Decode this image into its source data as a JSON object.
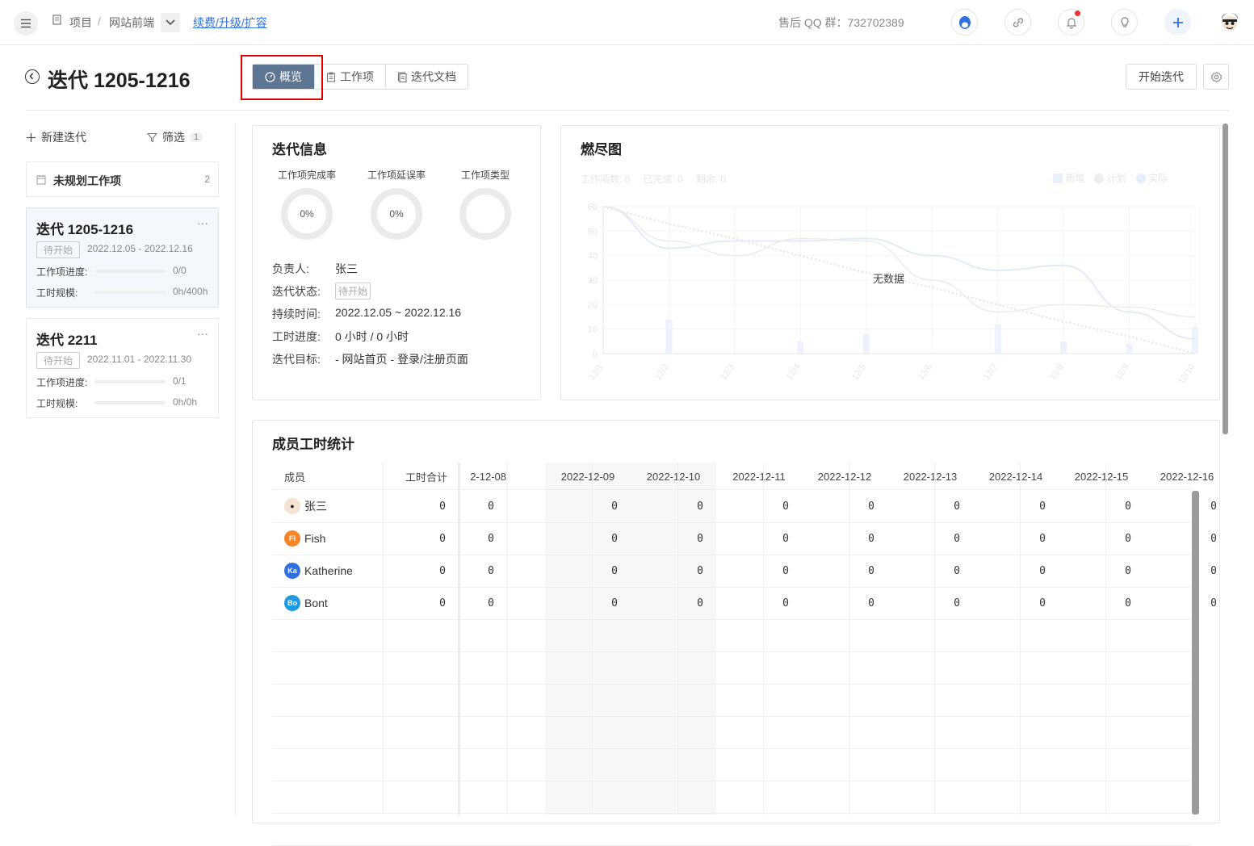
{
  "topbar": {
    "breadcrumb_project": "项目",
    "breadcrumb_sep": "/",
    "breadcrumb_current": "网站前端",
    "renew_link": "续费/升级/扩容",
    "qq_group": "售后 QQ 群：732702389"
  },
  "header": {
    "title": "迭代 1205-1216",
    "tabs": [
      {
        "label": "概览",
        "icon": "dashboard-icon"
      },
      {
        "label": "工作项",
        "icon": "clipboard-icon"
      },
      {
        "label": "迭代文档",
        "icon": "document-icon"
      }
    ],
    "start_button": "开始迭代"
  },
  "sidebar": {
    "new_iteration": "新建迭代",
    "filter": "筛选",
    "filter_count": "1",
    "unplanned_label": "未规划工作项",
    "unplanned_count": "2",
    "iterations": [
      {
        "name": "迭代 1205-1216",
        "status": "待开始",
        "dates": "2022.12.05 - 2022.12.16",
        "progress_label": "工作项进度:",
        "progress_value": "0/0",
        "hours_label": "工时规模:",
        "hours_value": "0h/400h"
      },
      {
        "name": "迭代 2211",
        "status": "待开始",
        "dates": "2022.11.01 - 2022.11.30",
        "progress_label": "工作项进度:",
        "progress_value": "0/1",
        "hours_label": "工时规模:",
        "hours_value": "0h/0h"
      }
    ]
  },
  "info": {
    "title": "迭代信息",
    "rings": [
      {
        "label": "工作项完成率",
        "value": "0%"
      },
      {
        "label": "工作项延误率",
        "value": "0%"
      },
      {
        "label": "工作项类型",
        "value": ""
      }
    ],
    "owner_label": "负责人:",
    "owner": "张三",
    "status_label": "迭代状态:",
    "status": "待开始",
    "duration_label": "持续时间:",
    "duration": "2022.12.05 ~ 2022.12.16",
    "hours_label": "工时进度:",
    "hours": "0 小时 / 0 小时",
    "goal_label": "迭代目标:",
    "goal": "- 网站首页 - 登录/注册页面"
  },
  "chart_data": {
    "type": "line",
    "title": "燃尽图",
    "summary": [
      "工作项数: 0",
      "已完成: 0",
      "剩余: 0"
    ],
    "legend": [
      "新增",
      "计划",
      "实际"
    ],
    "no_data": "无数据",
    "categories": [
      "12/1",
      "12/2",
      "12/3",
      "12/4",
      "12/5",
      "12/6",
      "12/7",
      "12/8",
      "12/9",
      "12/10"
    ],
    "ylim": [
      0,
      60
    ],
    "yticks": [
      0,
      10,
      20,
      30,
      40,
      50,
      60
    ],
    "series": [
      {
        "name": "新增",
        "values": [
          0,
          14,
          0,
          5,
          8,
          0,
          12,
          5,
          4,
          11
        ]
      },
      {
        "name": "计划",
        "values": [
          60,
          53,
          47,
          40,
          33,
          27,
          20,
          13,
          7,
          0
        ]
      },
      {
        "name": "实际",
        "values": [
          60,
          43,
          46,
          46,
          47,
          40,
          34,
          36,
          17,
          6
        ]
      },
      {
        "values": [
          60,
          46,
          40,
          47,
          46,
          30,
          17,
          20,
          19,
          15
        ]
      }
    ]
  },
  "members": {
    "title": "成员工时统计",
    "col_member": "成员",
    "col_total": "工时合计",
    "dates": [
      "2-12-08",
      "2022-12-09",
      "2022-12-10",
      "2022-12-11",
      "2022-12-12",
      "2022-12-13",
      "2022-12-14",
      "2022-12-15",
      "2022-12-16"
    ],
    "rows": [
      {
        "name": "张三",
        "initials": "",
        "color": "#444444",
        "total": "0",
        "values": [
          "0",
          "0",
          "0",
          "0",
          "0",
          "0",
          "0",
          "0",
          "0"
        ]
      },
      {
        "name": "Fish",
        "initials": "Fi",
        "color": "#f5862a",
        "total": "0",
        "values": [
          "0",
          "0",
          "0",
          "0",
          "0",
          "0",
          "0",
          "0",
          "0"
        ]
      },
      {
        "name": "Katherine",
        "initials": "Ka",
        "color": "#2f6fe0",
        "total": "0",
        "values": [
          "0",
          "0",
          "0",
          "0",
          "0",
          "0",
          "0",
          "0",
          "0"
        ]
      },
      {
        "name": "Bont",
        "initials": "Bo",
        "color": "#1f9ae0",
        "total": "0",
        "values": [
          "0",
          "0",
          "0",
          "0",
          "0",
          "0",
          "0",
          "0",
          "0"
        ]
      }
    ]
  }
}
